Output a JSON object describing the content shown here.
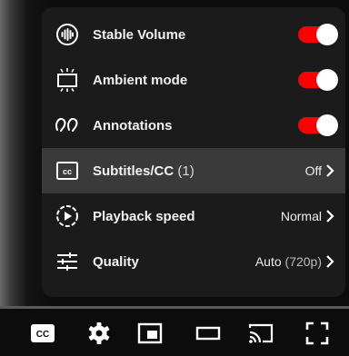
{
  "settings_menu": {
    "items": [
      {
        "label": "Stable Volume",
        "icon": "stable-volume-icon",
        "type": "toggle",
        "value": true
      },
      {
        "label": "Ambient mode",
        "icon": "ambient-mode-icon",
        "type": "toggle",
        "value": true
      },
      {
        "label": "Annotations",
        "icon": "annotations-icon",
        "type": "toggle",
        "value": true
      },
      {
        "label": "Subtitles/CC",
        "sublabel": "(1)",
        "icon": "subtitles-icon",
        "type": "submenu",
        "value": "Off"
      },
      {
        "label": "Playback speed",
        "icon": "playback-speed-icon",
        "type": "submenu",
        "value": "Normal"
      },
      {
        "label": "Quality",
        "icon": "quality-icon",
        "type": "submenu",
        "value_main": "Auto",
        "value_sub": "(720p)"
      }
    ],
    "toggle_on_color": "#ff0000"
  },
  "control_bar": {
    "buttons": [
      "subtitles-icon",
      "settings-gear-icon",
      "miniplayer-icon",
      "theater-mode-icon",
      "cast-icon",
      "fullscreen-icon"
    ]
  }
}
